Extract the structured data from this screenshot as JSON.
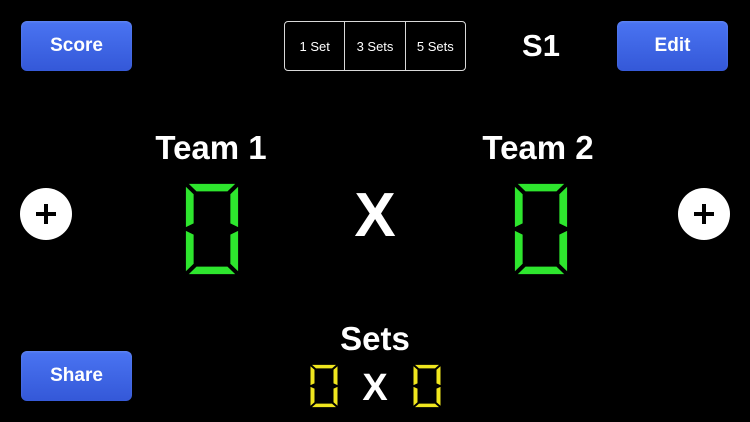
{
  "toolbar": {
    "score_label": "Score",
    "edit_label": "Edit",
    "share_label": "Share"
  },
  "set_options": [
    {
      "label": "1 Set"
    },
    {
      "label": "3 Sets"
    },
    {
      "label": "5 Sets"
    }
  ],
  "current_set": "S1",
  "teams": [
    {
      "name": "Team 1",
      "score": "0",
      "sets": "0"
    },
    {
      "name": "Team 2",
      "score": "0",
      "sets": "0"
    }
  ],
  "versus": "X",
  "sets_section": {
    "label": "Sets",
    "separator": "X"
  },
  "colors": {
    "background": "#000000",
    "button": "#3f66e6",
    "score_digits": "#2ee62e",
    "set_digits": "#f0e61e",
    "text": "#ffffff"
  },
  "icons": {
    "add": "plus-icon"
  }
}
